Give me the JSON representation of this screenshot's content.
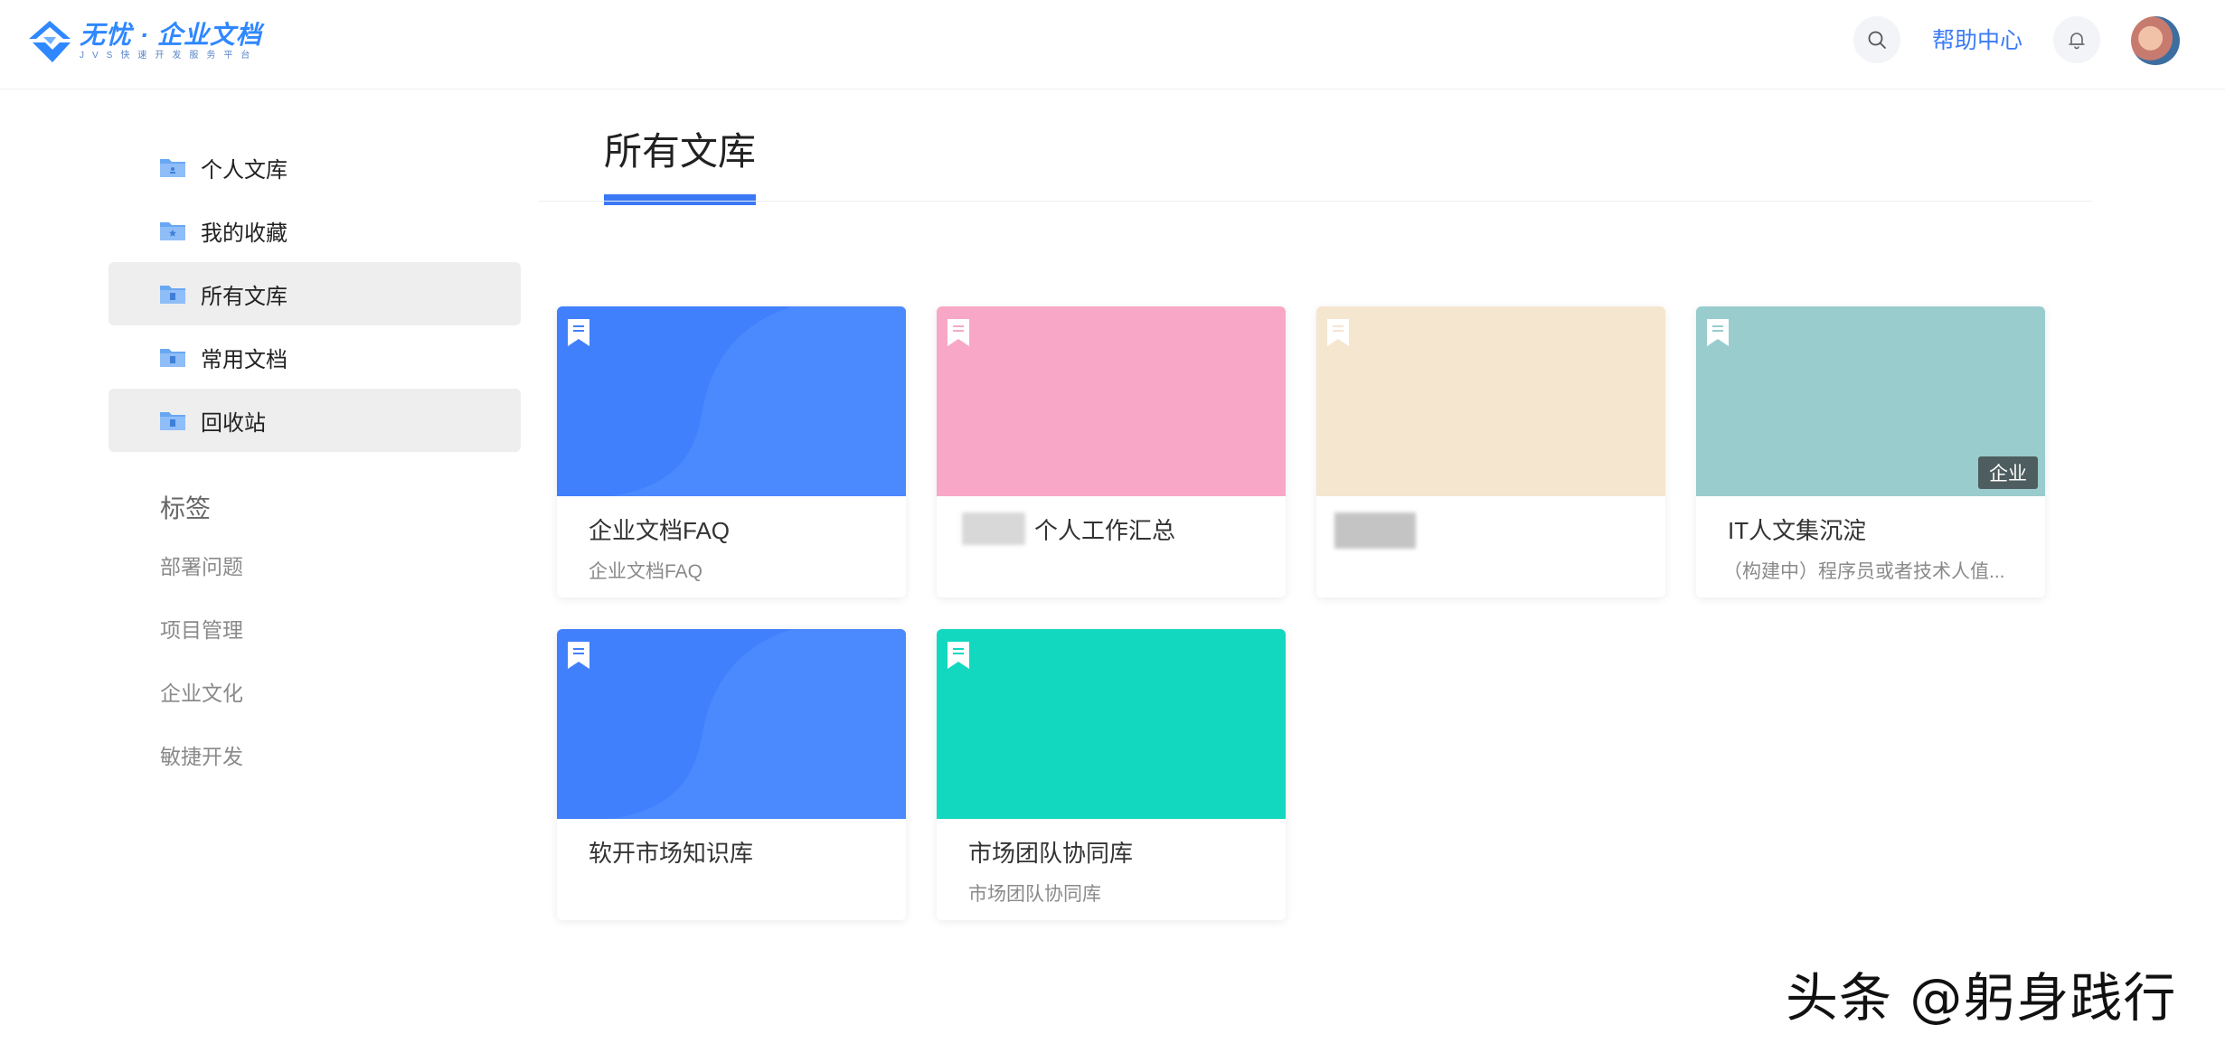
{
  "header": {
    "logo_title": "无忧 · 企业文档",
    "logo_subtitle": "JVS快速开发服务平台",
    "help_label": "帮助中心"
  },
  "sidebar": {
    "items": [
      {
        "label": "个人文库"
      },
      {
        "label": "我的收藏"
      },
      {
        "label": "所有文库"
      },
      {
        "label": "常用文档"
      },
      {
        "label": "回收站"
      }
    ],
    "tags_title": "标签",
    "tags": [
      "部署问题",
      "项目管理",
      "企业文化",
      "敏捷开发"
    ]
  },
  "main": {
    "page_title": "所有文库",
    "cards": [
      {
        "title": "企业文档FAQ",
        "desc": "企业文档FAQ",
        "color": "#4180fd"
      },
      {
        "title": "个人工作汇总",
        "desc": "",
        "color": "#f8a8c6"
      },
      {
        "title": "",
        "desc": "",
        "color": "#f5e6d0"
      },
      {
        "title": "IT人文集沉淀",
        "desc": "（构建中）程序员或者技术人值...",
        "color": "#99cccd",
        "badge": "企业"
      },
      {
        "title": "软开市场知识库",
        "desc": "",
        "color": "#4180fd"
      },
      {
        "title": "市场团队协同库",
        "desc": "市场团队协同库",
        "color": "#12d8c0"
      }
    ]
  },
  "watermark": "头条 @躬身践行",
  "colors": {
    "accent": "#3b78f5",
    "active_bg": "#eeeeee"
  }
}
